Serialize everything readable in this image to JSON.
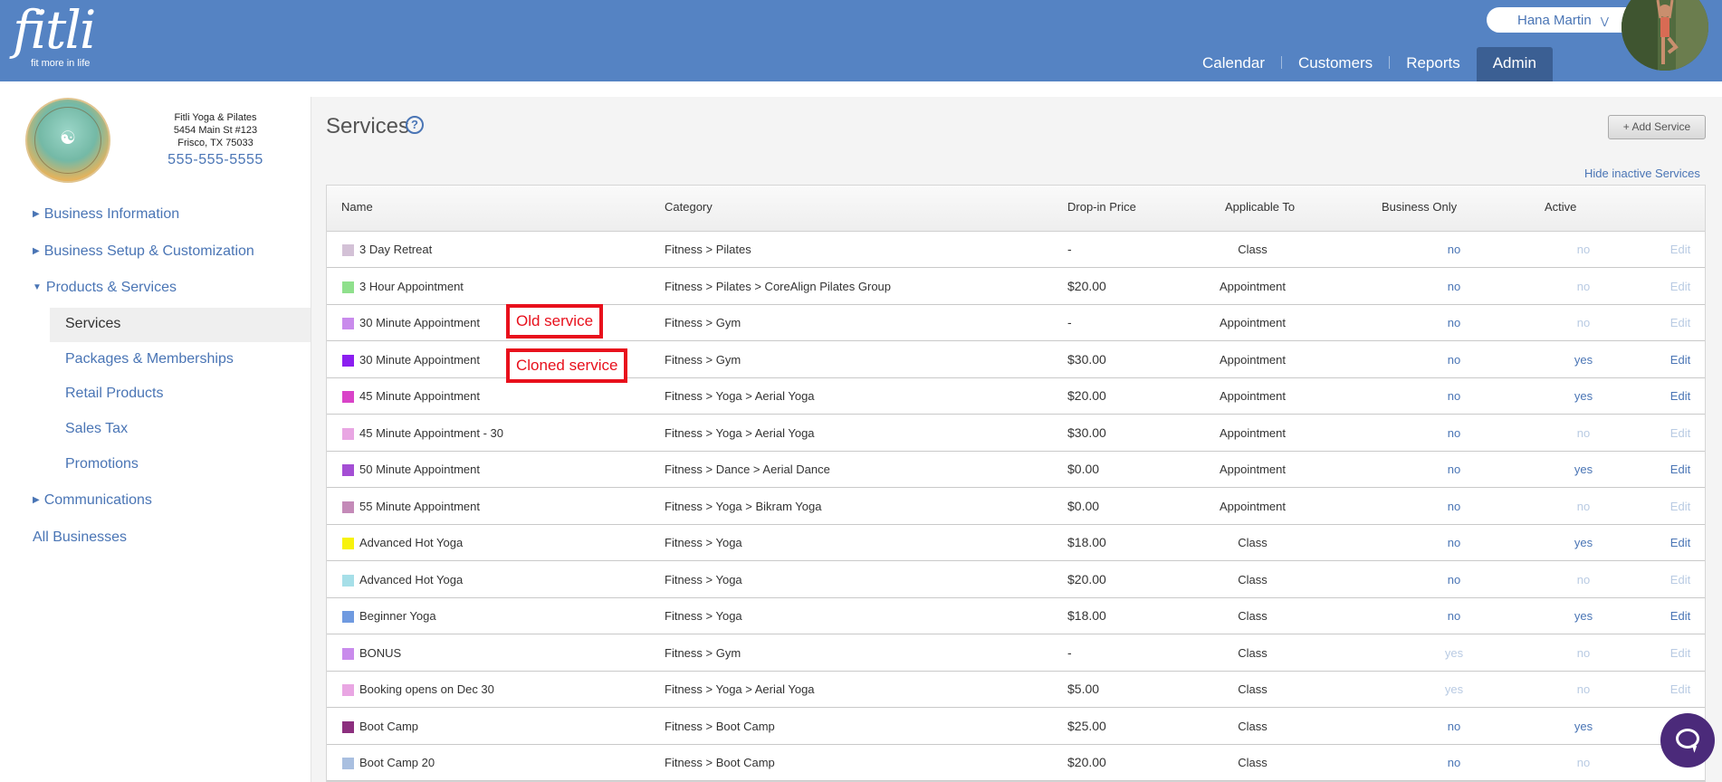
{
  "header": {
    "logo_word": "fitli",
    "logo_tagline": "fit more in life",
    "user_name": "Hana Martin",
    "user_menu_icon": "chevron-double-down-icon",
    "nav": [
      {
        "label": "Calendar",
        "active": false
      },
      {
        "label": "Customers",
        "active": false
      },
      {
        "label": "Reports",
        "active": false
      },
      {
        "label": "Admin",
        "active": true
      }
    ]
  },
  "business": {
    "logo_text": "FITLI YOGA & PILATES",
    "name": "Fitli Yoga & Pilates",
    "address1": "5454 Main St #123",
    "address2": "Frisco, TX 75033",
    "phone": "555-555-5555"
  },
  "sidebar": {
    "items": [
      {
        "label": "Business Information",
        "expanded": false
      },
      {
        "label": "Business Setup & Customization",
        "expanded": false
      },
      {
        "label": "Products & Services",
        "expanded": true
      },
      {
        "label": "Communications",
        "expanded": false
      },
      {
        "label": "All Businesses",
        "expanded": false
      }
    ],
    "subitems": [
      "Services",
      "Packages & Memberships",
      "Retail Products",
      "Sales Tax",
      "Promotions"
    ],
    "active_subitem": "Services"
  },
  "page": {
    "title": "Services",
    "add_button": "+ Add Service",
    "hide_inactive": "Hide inactive Services"
  },
  "table": {
    "columns": [
      "Name",
      "Category",
      "Drop-in Price",
      "Applicable To",
      "Business Only",
      "Active",
      ""
    ],
    "rows": [
      {
        "color": "#d3c1d6",
        "name": "3 Day Retreat",
        "category": "Fitness > Pilates",
        "price": "-",
        "applicable": "Class",
        "business_only": "no",
        "active": "no",
        "edit": "Edit"
      },
      {
        "color": "#8fe08c",
        "name": "3 Hour Appointment",
        "category": "Fitness > Pilates > CoreAlign Pilates Group",
        "price": "$20.00",
        "applicable": "Appointment",
        "business_only": "no",
        "active": "no",
        "edit": "Edit"
      },
      {
        "color": "#c98bec",
        "name": "30 Minute Appointment",
        "category": "Fitness > Gym",
        "price": "-",
        "applicable": "Appointment",
        "business_only": "no",
        "active": "no",
        "edit": "Edit"
      },
      {
        "color": "#8b1ef0",
        "name": "30 Minute Appointment",
        "category": "Fitness > Gym",
        "price": "$30.00",
        "applicable": "Appointment",
        "business_only": "no",
        "active": "yes",
        "edit": "Edit"
      },
      {
        "color": "#d943c8",
        "name": "45 Minute Appointment",
        "category": "Fitness > Yoga > Aerial Yoga",
        "price": "$20.00",
        "applicable": "Appointment",
        "business_only": "no",
        "active": "yes",
        "edit": "Edit"
      },
      {
        "color": "#e9a6e3",
        "name": "45 Minute Appointment - 30",
        "category": "Fitness > Yoga > Aerial Yoga",
        "price": "$30.00",
        "applicable": "Appointment",
        "business_only": "no",
        "active": "no",
        "edit": "Edit"
      },
      {
        "color": "#a44ed4",
        "name": "50 Minute Appointment",
        "category": "Fitness > Dance > Aerial Dance",
        "price": "$0.00",
        "applicable": "Appointment",
        "business_only": "no",
        "active": "yes",
        "edit": "Edit"
      },
      {
        "color": "#c48ab8",
        "name": "55 Minute Appointment",
        "category": "Fitness > Yoga > Bikram Yoga",
        "price": "$0.00",
        "applicable": "Appointment",
        "business_only": "no",
        "active": "no",
        "edit": "Edit"
      },
      {
        "color": "#f7f20c",
        "name": "Advanced Hot Yoga",
        "category": "Fitness > Yoga",
        "price": "$18.00",
        "applicable": "Class",
        "business_only": "no",
        "active": "yes",
        "edit": "Edit"
      },
      {
        "color": "#a6dfe8",
        "name": "Advanced Hot Yoga",
        "category": "Fitness > Yoga",
        "price": "$20.00",
        "applicable": "Class",
        "business_only": "no",
        "active": "no",
        "edit": "Edit"
      },
      {
        "color": "#6f9ae0",
        "name": "Beginner Yoga",
        "category": "Fitness > Yoga",
        "price": "$18.00",
        "applicable": "Class",
        "business_only": "no",
        "active": "yes",
        "edit": "Edit"
      },
      {
        "color": "#c98bec",
        "name": "BONUS",
        "category": "Fitness > Gym",
        "price": "-",
        "applicable": "Class",
        "business_only": "yes",
        "active": "no",
        "edit": "Edit"
      },
      {
        "color": "#e9a6e3",
        "name": "Booking opens on Dec 30",
        "category": "Fitness > Yoga > Aerial Yoga",
        "price": "$5.00",
        "applicable": "Class",
        "business_only": "yes",
        "active": "no",
        "edit": "Edit"
      },
      {
        "color": "#8c2f7e",
        "name": "Boot Camp",
        "category": "Fitness > Boot Camp",
        "price": "$25.00",
        "applicable": "Class",
        "business_only": "no",
        "active": "yes",
        "edit": ""
      },
      {
        "color": "#a9bfe0",
        "name": "Boot Camp 20",
        "category": "Fitness > Boot Camp",
        "price": "$20.00",
        "applicable": "Class",
        "business_only": "no",
        "active": "no",
        "edit": ""
      }
    ]
  },
  "annotations": {
    "old_service": "Old service",
    "cloned_service": "Cloned service"
  },
  "chat": {
    "icon": "chat-bubble-icon",
    "color": "#4b2a7a"
  }
}
